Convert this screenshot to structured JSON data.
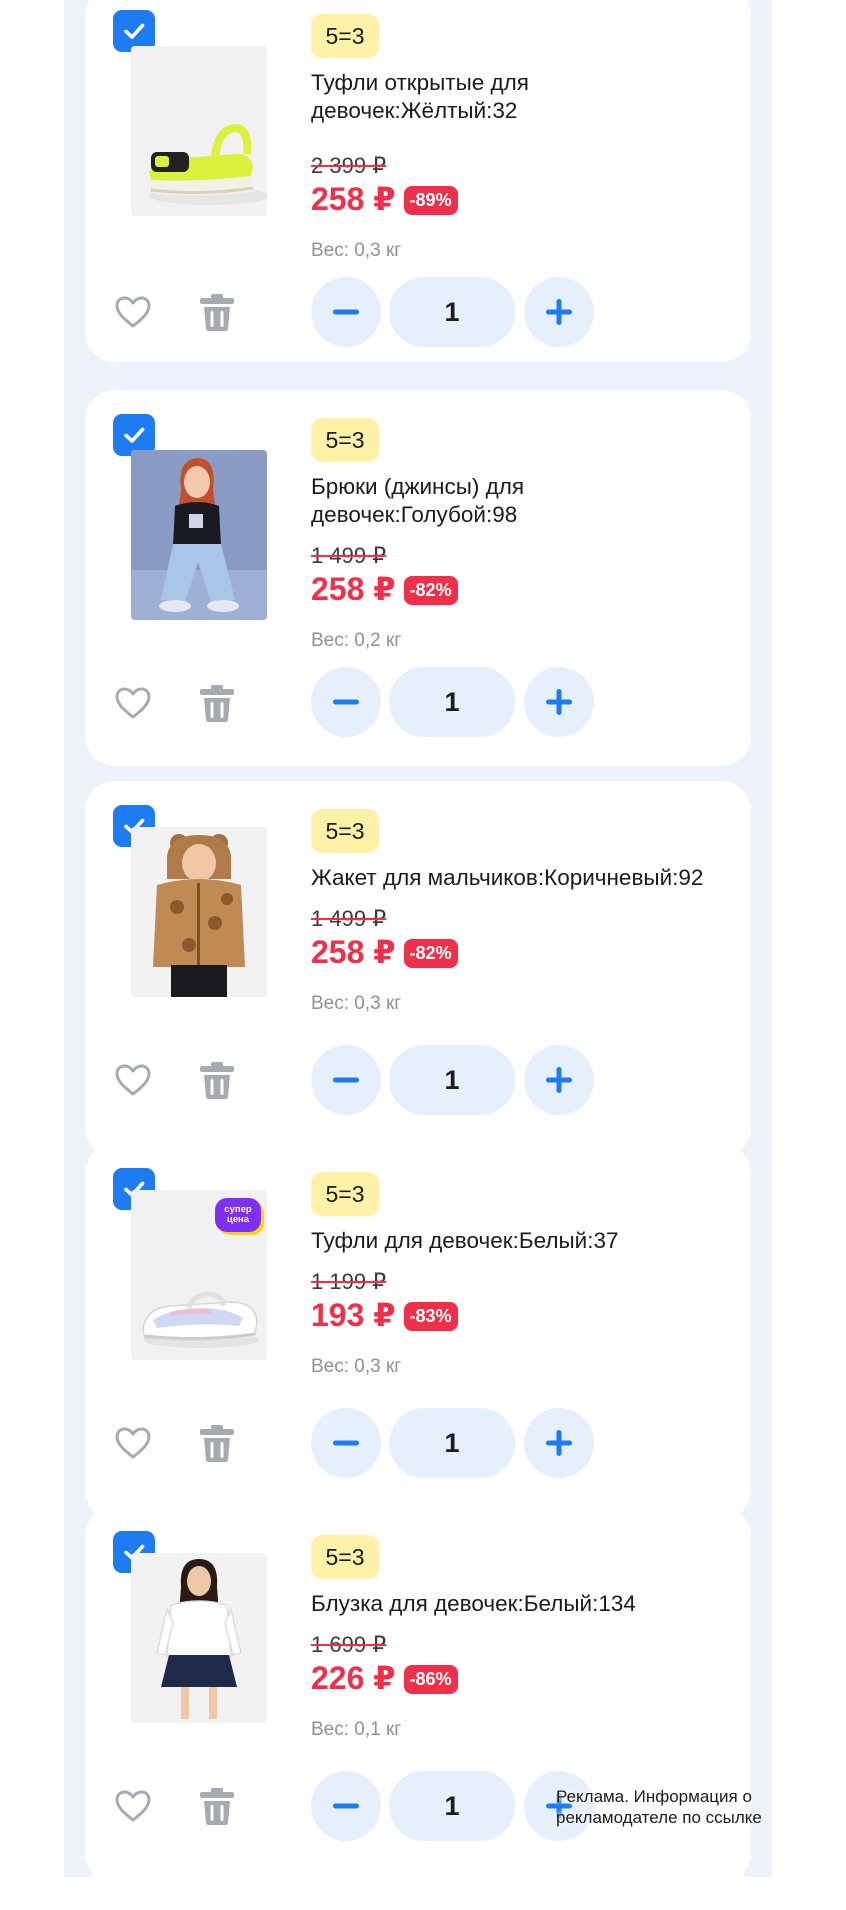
{
  "colors": {
    "accent": "#1e7cf2",
    "sale": "#f0304a",
    "promo_badge": "#fff1a8",
    "page_bg": "#eef3fb"
  },
  "items": [
    {
      "checked": true,
      "promo": "5=3",
      "title": "Туфли открытые для девочек:Жёлтый:32",
      "old_price": "2 399 ₽",
      "price": "258 ₽",
      "discount": "-89%",
      "weight": "Вес: 0,3 кг",
      "qty": "1",
      "image": "yellow-sandal"
    },
    {
      "checked": true,
      "promo": "5=3",
      "title": "Брюки (джинсы) для девочек:Голубой:98",
      "old_price": "1 499 ₽",
      "price": "258 ₽",
      "discount": "-82%",
      "weight": "Вес: 0,2 кг",
      "qty": "1",
      "image": "girl-in-jeans"
    },
    {
      "checked": true,
      "promo": "5=3",
      "title": "Жакет для мальчиков:Коричневый:92",
      "old_price": "1 499 ₽",
      "price": "258 ₽",
      "discount": "-82%",
      "weight": "Вес: 0,3 кг",
      "qty": "1",
      "image": "boy-in-brown-jacket"
    },
    {
      "checked": true,
      "promo": "5=3",
      "title": "Туфли для девочек:Белый:37",
      "old_price": "1 199 ₽",
      "price": "193 ₽",
      "discount": "-83%",
      "weight": "Вес: 0,3 кг",
      "qty": "1",
      "image": "white-shoe",
      "sticker": "супер цена"
    },
    {
      "checked": true,
      "promo": "5=3",
      "title": "Блузка для девочек:Белый:134",
      "old_price": "1 699 ₽",
      "price": "226 ₽",
      "discount": "-86%",
      "weight": "Вес: 0,1 кг",
      "qty": "1",
      "image": "girl-in-white-blouse"
    }
  ],
  "ad_note": "Реклама. Информация о рекламодателе по ссылке"
}
